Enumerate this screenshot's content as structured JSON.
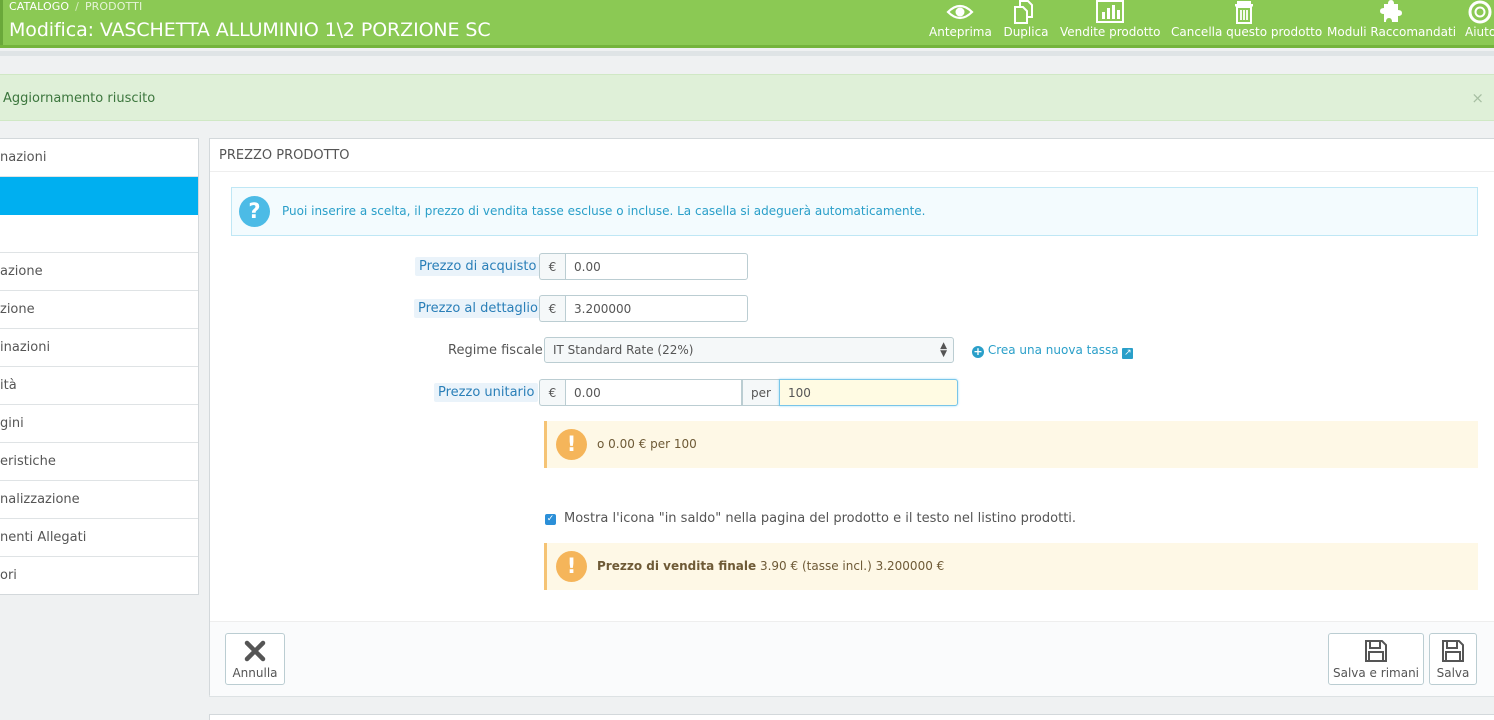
{
  "header": {
    "breadcrumb": [
      "CATALOGO",
      "PRODOTTI"
    ],
    "breadcrumb_separator": "/",
    "title": "Modifica: VASCHETTA ALLUMINIO 1\\2 PORZIONE SC",
    "toolbar": {
      "preview": "Anteprima",
      "duplicate": "Duplica",
      "sales": "Vendite prodotto",
      "delete": "Cancella questo prodotto",
      "modules": "Moduli Raccomandati",
      "help": "Aiuto"
    },
    "colors": {
      "header_bg": "#8bc954",
      "active_tab": "#00aff0"
    }
  },
  "alert_success": {
    "message": "Aggiornamento riuscito",
    "close": "×"
  },
  "sidebar": {
    "items": [
      {
        "label": "nazioni"
      },
      {
        "label": ""
      },
      {
        "label": ""
      },
      {
        "label": "azione"
      },
      {
        "label": "zione"
      },
      {
        "label": "inazioni"
      },
      {
        "label": "ità"
      },
      {
        "label": "gini"
      },
      {
        "label": "eristiche"
      },
      {
        "label": "nalizzazione"
      },
      {
        "label": "nenti Allegati"
      },
      {
        "label": "ori"
      }
    ]
  },
  "panel": {
    "heading": "PREZZO PRODOTTO",
    "info": {
      "icon": "?",
      "text": "Puoi inserire a scelta, il prezzo di vendita tasse escluse o incluse. La casella si adeguerà automaticamente."
    },
    "purchase_price": {
      "label": "Prezzo di acquisto",
      "currency": "€",
      "value": "0.00"
    },
    "retail_price": {
      "label": "Prezzo al dettaglio",
      "currency": "€",
      "value": "3.200000"
    },
    "tax_rule": {
      "label": "Regime fiscale",
      "selected": "IT Standard Rate (22%)",
      "create_link": "Crea una nuova tassa"
    },
    "unit_price": {
      "label": "Prezzo unitario",
      "currency": "€",
      "value": "0.00",
      "per_label": "per",
      "per_value": "100"
    },
    "unit_warning": {
      "icon": "!",
      "text": "o 0.00 € per 100"
    },
    "on_sale": {
      "checked": true,
      "label": "Mostra l'icona \"in saldo\" nella pagina del prodotto e il testo nel listino prodotti."
    },
    "final_price": {
      "icon": "!",
      "bold": "Prezzo di vendita finale",
      "text": "3.90 € (tasse incl.) 3.200000 €"
    },
    "footer": {
      "cancel": "Annulla",
      "save_stay": "Salva e rimani",
      "save": "Salva"
    }
  }
}
